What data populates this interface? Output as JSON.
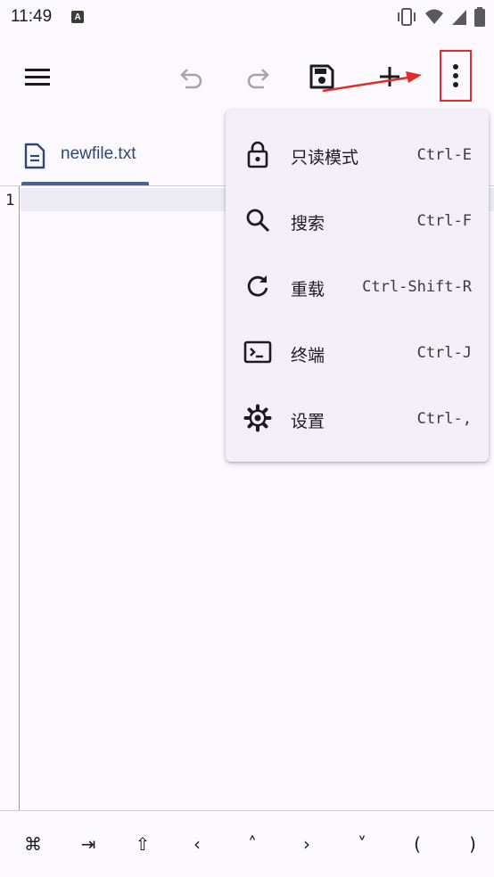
{
  "status": {
    "time": "11:49",
    "app_badge": "A"
  },
  "toolbar": {
    "menu_icon": "hamburger-menu-icon",
    "undo_icon": "undo-icon",
    "redo_icon": "redo-icon",
    "save_icon": "save-icon",
    "add_icon": "add-icon",
    "more_icon": "more-vert-icon"
  },
  "tab": {
    "label": "newfile.txt",
    "icon": "document-icon"
  },
  "editor": {
    "line_numbers": [
      "1"
    ]
  },
  "menu": {
    "items": [
      {
        "label": "只读模式",
        "shortcut": "Ctrl-E",
        "icon": "lock-icon"
      },
      {
        "label": "搜索",
        "shortcut": "Ctrl-F",
        "icon": "search-icon"
      },
      {
        "label": "重载",
        "shortcut": "Ctrl-Shift-R",
        "icon": "refresh-icon"
      },
      {
        "label": "终端",
        "shortcut": "Ctrl-J",
        "icon": "terminal-icon"
      },
      {
        "label": "设置",
        "shortcut": "Ctrl-,",
        "icon": "settings-gear-icon"
      }
    ]
  },
  "keys": {
    "items": [
      "⌘",
      "⇥",
      "⇧",
      "‹",
      "˄",
      "›",
      "˅",
      "(",
      ")"
    ]
  },
  "colors": {
    "accent": "#48618f",
    "highlight_border": "#e02b2b",
    "menu_bg": "#f3eff6",
    "background": "#fbf8fe"
  }
}
